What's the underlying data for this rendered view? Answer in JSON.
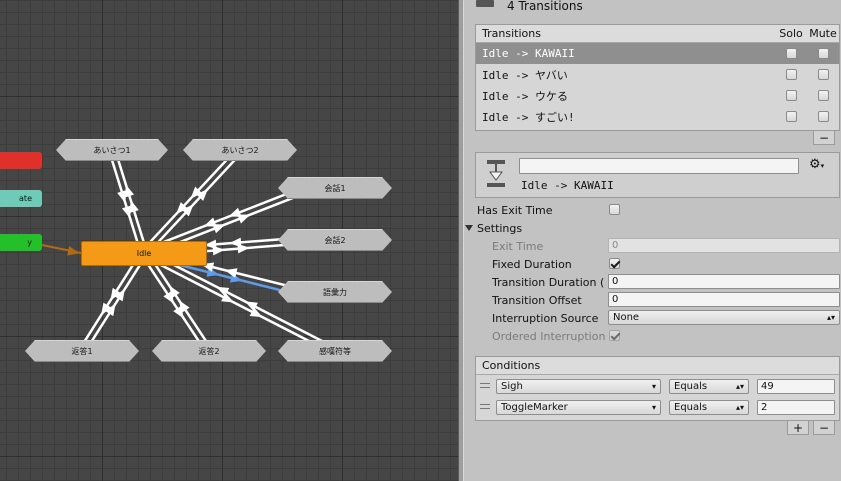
{
  "graph": {
    "states": [
      {
        "id": "greet1",
        "label": "あいさつ1"
      },
      {
        "id": "greet2",
        "label": "あいさつ2"
      },
      {
        "id": "talk1",
        "label": "会話1"
      },
      {
        "id": "talk2",
        "label": "会話2"
      },
      {
        "id": "vocab",
        "label": "語彙力"
      },
      {
        "id": "reply1",
        "label": "返答1"
      },
      {
        "id": "reply2",
        "label": "返答2"
      },
      {
        "id": "sarcasm",
        "label": "感嘆符等"
      }
    ],
    "default_state": {
      "label": "Idle",
      "color": "#f49a17"
    },
    "edge_nodes": [
      {
        "label": "",
        "color": "#e0302a"
      },
      {
        "label": "ate",
        "color": "#6fcbb8"
      },
      {
        "label": "y",
        "color": "#24c02a"
      }
    ],
    "transition_color": "#ffffff",
    "selected_transition_color": "#5e9bea",
    "entry_arrow_color": "#b06a12"
  },
  "inspector": {
    "header": {
      "title": "4 Transitions"
    },
    "transitions": {
      "header": {
        "label": "Transitions",
        "solo": "Solo",
        "mute": "Mute"
      },
      "rows": [
        {
          "label": "Idle -> KAWAII",
          "selected": true
        },
        {
          "label": "Idle -> ヤバい",
          "selected": false
        },
        {
          "label": "Idle -> ウケる",
          "selected": false
        },
        {
          "label": "Idle -> すごい!",
          "selected": false
        }
      ],
      "remove_button": "−"
    },
    "transition_detail": {
      "name_value": "",
      "subtitle": "Idle -> KAWAII",
      "settings_icon": "gear-icon"
    },
    "has_exit_time": {
      "label": "Has Exit Time",
      "checked": false
    },
    "settings": {
      "label": "Settings",
      "exit_time": {
        "label": "Exit Time",
        "value": "0"
      },
      "fixed_duration": {
        "label": "Fixed Duration",
        "checked": true
      },
      "transition_duration": {
        "label": "Transition Duration (",
        "value": "0"
      },
      "transition_offset": {
        "label": "Transition Offset",
        "value": "0"
      },
      "interruption_source": {
        "label": "Interruption Source",
        "value": "None"
      },
      "ordered_interruption": {
        "label": "Ordered Interruption",
        "checked": true
      }
    },
    "conditions": {
      "label": "Conditions",
      "rows": [
        {
          "parameter": "Sigh",
          "operator": "Equals",
          "value": "49"
        },
        {
          "parameter": "ToggleMarker",
          "operator": "Equals",
          "value": "2"
        }
      ],
      "add_button": "+",
      "remove_button": "−"
    }
  }
}
